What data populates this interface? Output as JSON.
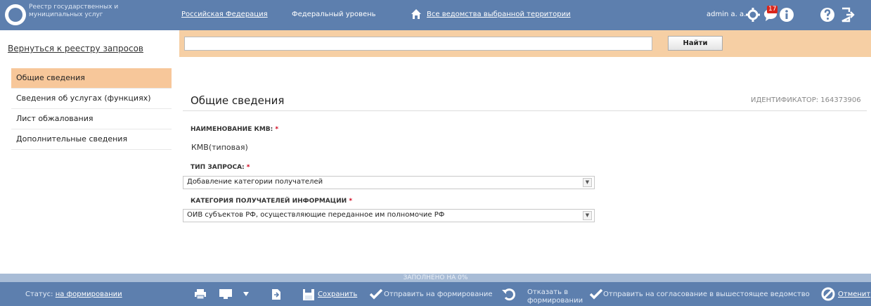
{
  "header": {
    "brand_line1": "Реестр государственных и",
    "brand_line2": "муниципальных услуг",
    "region_link": "Российская Федерация",
    "level": "Федеральный уровень",
    "agencies_link": "Все ведомства выбранной территории",
    "user": "admin a. a.",
    "notification_count": "17"
  },
  "nav": {
    "back_link": "Вернуться к реестру запросов",
    "items": [
      {
        "label": "Общие сведения"
      },
      {
        "label": "Сведения об услугах (функциях)"
      },
      {
        "label": "Лист обжалования"
      },
      {
        "label": "Дополнительные сведения"
      }
    ]
  },
  "search": {
    "value": "",
    "button": "Найти"
  },
  "section": {
    "title": "Общие сведения",
    "identifier": "ИДЕНТИФИКАТОР: 164373906"
  },
  "fields": {
    "kmv_label": "НАИМЕНОВАНИЕ КМВ:",
    "kmv_value": "КМВ(типовая)",
    "request_type_label": "ТИП ЗАПРОСА:",
    "request_type_value": "Добавление категории получателей",
    "category_label": "КАТЕГОРИЯ ПОЛУЧАТЕЛЕЙ ИНФОРМАЦИИ",
    "category_value": "ОИВ субъектов РФ, осуществляющие переданное им полномочие РФ",
    "required_mark": "*"
  },
  "footer": {
    "progress_text": "ЗАПОЛНЕНО НА 0%",
    "progress_value": 0,
    "status_label": "Статус:",
    "status_value": "на формировании",
    "save": "Сохранить",
    "send_forming": "Отправить на формирование",
    "refuse_line1": "Отказать в",
    "refuse_line2": "формировании",
    "send_approval": "Отправить на согласование в вышестоящее ведомство",
    "cancel": "Отменит"
  },
  "colors": {
    "header_bg": "#5d7fae",
    "accent_orange": "#f6cfa4",
    "active_nav": "#f7c79a",
    "required": "#d0021b"
  }
}
